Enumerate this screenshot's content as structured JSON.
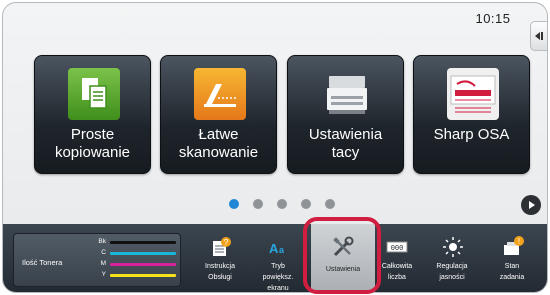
{
  "status": {
    "time": "10:15"
  },
  "tiles": [
    {
      "label": "Proste\nkopiowanie",
      "icon": "copy-icon"
    },
    {
      "label": "Łatwe\nskanowanie",
      "icon": "scan-icon"
    },
    {
      "label": "Ustawienia\ntacy",
      "icon": "tray-settings-icon"
    },
    {
      "label": "Sharp OSA",
      "icon": "sharp-osa-icon"
    }
  ],
  "pagination": {
    "page_count": 5,
    "current_page": 1
  },
  "toner": {
    "title": "Ilość Tonera",
    "channels": [
      {
        "name": "Bk",
        "color": "#111111"
      },
      {
        "name": "C",
        "color": "#18b7d8"
      },
      {
        "name": "M",
        "color": "#d8219a"
      },
      {
        "name": "Y",
        "color": "#f3e21a"
      }
    ]
  },
  "bottom_buttons": [
    {
      "label": "Instrukcja\nObsługi",
      "icon": "manual-icon",
      "selected": false
    },
    {
      "label": "Tryb\npowiększ.\nekranu",
      "icon": "zoom-text-icon",
      "selected": false
    },
    {
      "label": "Ustawienia",
      "icon": "tools-icon",
      "selected": true
    },
    {
      "label": "Całkowita\nliczba",
      "icon": "counter-icon",
      "selected": false
    },
    {
      "label": "Regulacja\njasności",
      "icon": "brightness-icon",
      "selected": false
    },
    {
      "label": "Stan\nzadania",
      "icon": "job-status-icon",
      "selected": false
    }
  ],
  "colors": {
    "accent": "#1f87d6",
    "highlight": "#d11d40",
    "tile_bg": "#1f252c"
  }
}
